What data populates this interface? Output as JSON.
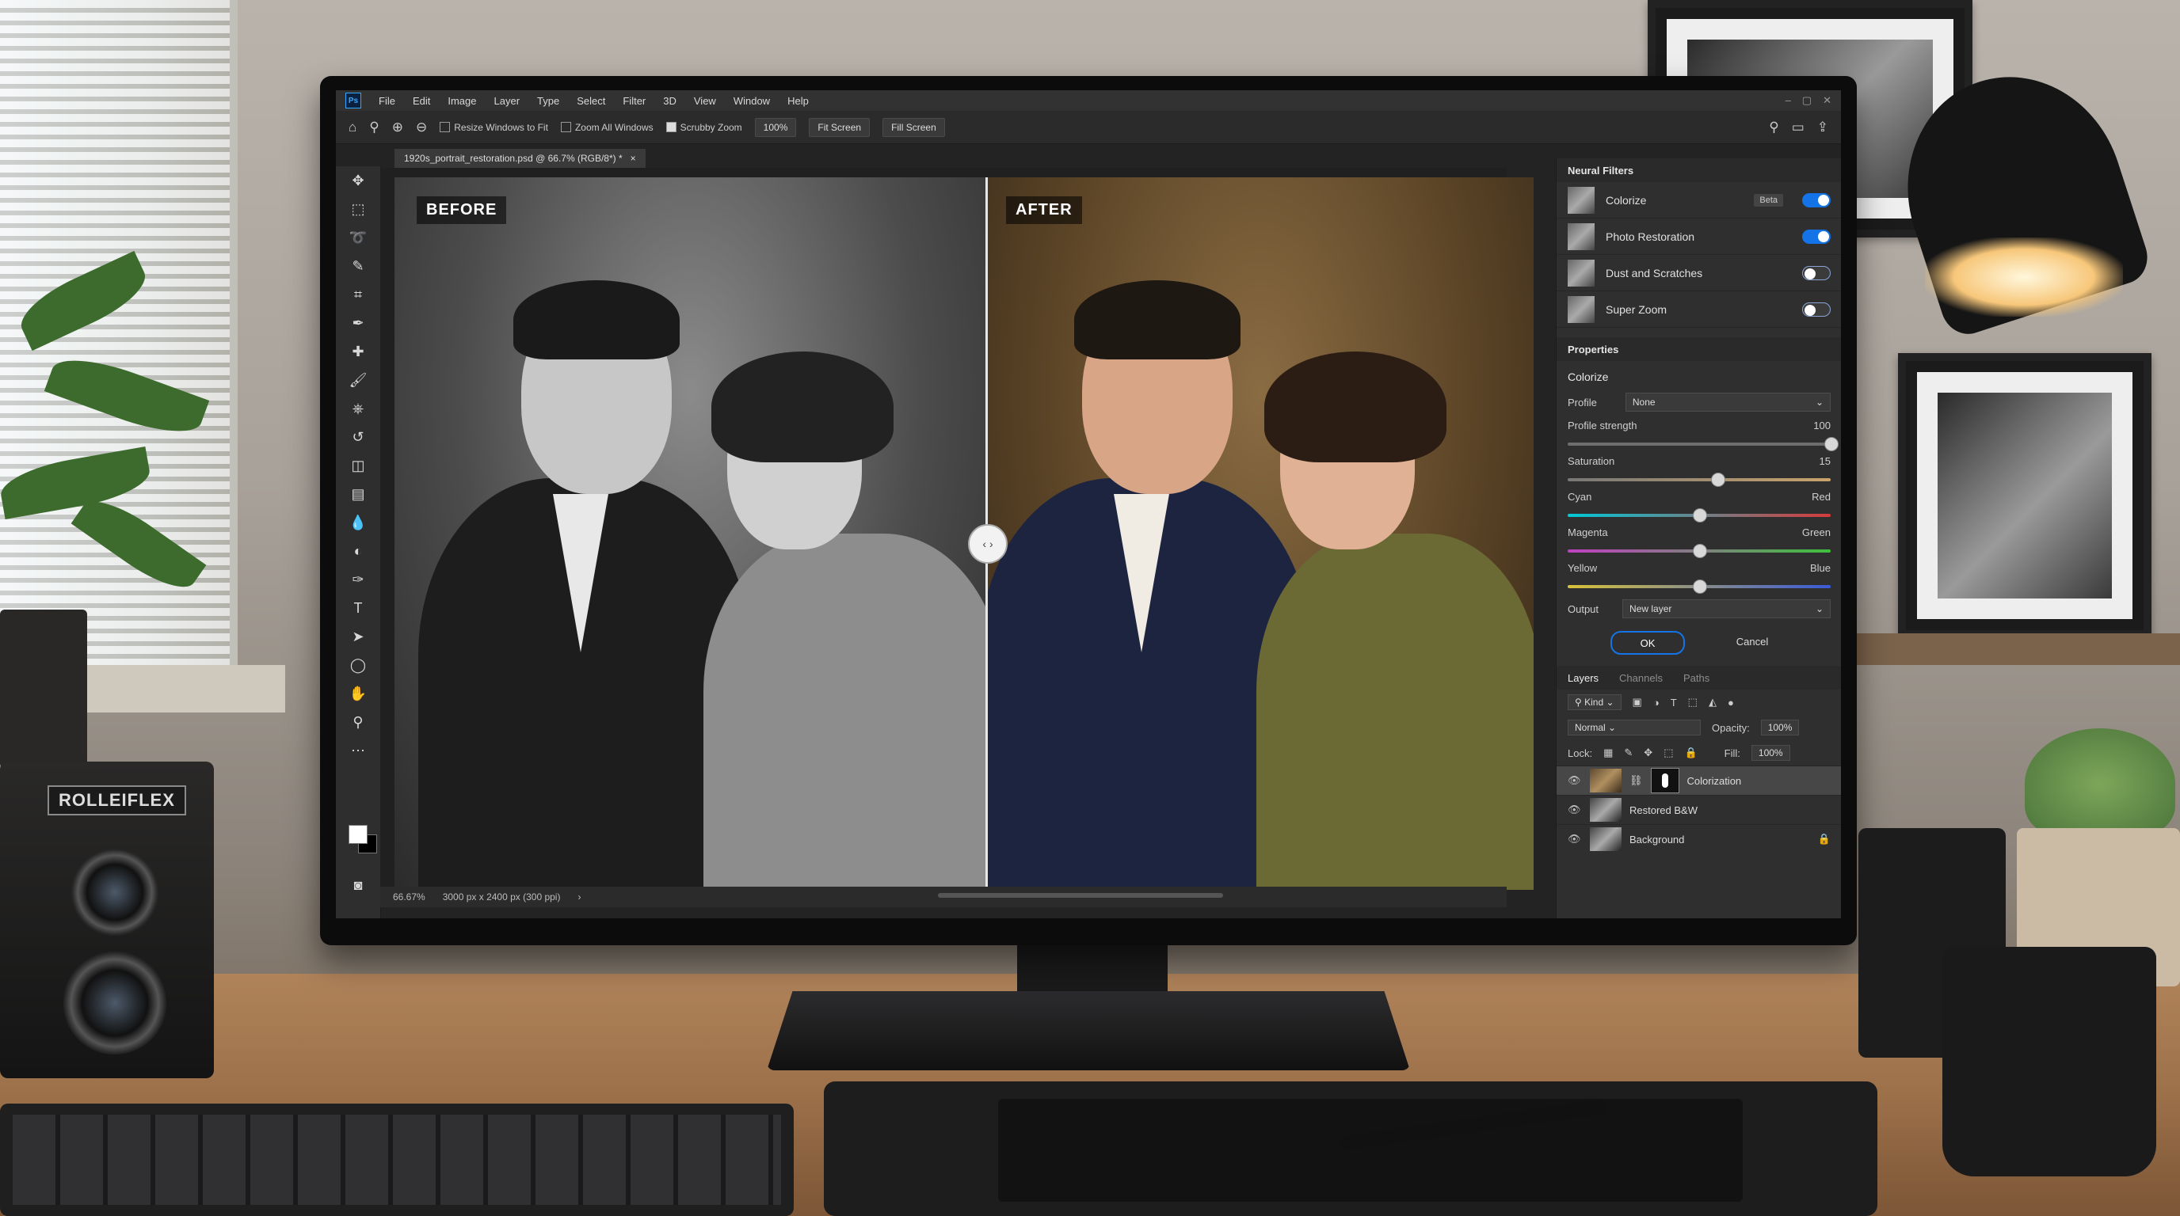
{
  "app": {
    "menu": [
      "File",
      "Edit",
      "Image",
      "Layer",
      "Type",
      "Select",
      "Filter",
      "3D",
      "View",
      "Window",
      "Help"
    ],
    "options_bar": {
      "resize_windows": "Resize Windows to Fit",
      "zoom_all": "Zoom All Windows",
      "scrubby_zoom": "Scrubby Zoom",
      "zoom_value": "100%",
      "fit_screen": "Fit Screen",
      "fill_screen": "Fill Screen"
    },
    "document_tab": "1920s_portrait_restoration.psd @ 66.7% (RGB/8*) *",
    "canvas": {
      "before_label": "BEFORE",
      "after_label": "AFTER"
    },
    "status_bar": {
      "zoom": "66.67%",
      "dimensions": "3000 px x 2400 px (300 ppi)"
    }
  },
  "neural_filters": {
    "title": "Neural Filters",
    "items": [
      {
        "name": "Colorize",
        "badge": "Beta",
        "enabled": true
      },
      {
        "name": "Photo Restoration",
        "enabled": true
      },
      {
        "name": "Dust and Scratches",
        "enabled": false
      },
      {
        "name": "Super Zoom",
        "enabled": false
      }
    ]
  },
  "properties": {
    "title": "Properties",
    "heading": "Colorize",
    "profile_label": "Profile",
    "profile_value": "None",
    "sliders": [
      {
        "left": "Profile strength",
        "right": "100",
        "value": 1.0
      },
      {
        "left": "Saturation",
        "right": "15",
        "value": 0.57
      },
      {
        "left": "Cyan",
        "right": "Red",
        "value": 0.5
      },
      {
        "left": "Magenta",
        "right": "Green",
        "value": 0.5
      },
      {
        "left": "Yellow",
        "right": "Blue",
        "value": 0.5
      }
    ],
    "output_label": "Output",
    "output_value": "New layer",
    "ok": "OK",
    "cancel": "Cancel"
  },
  "layers": {
    "tabs": [
      "Layers",
      "Channels",
      "Paths"
    ],
    "kind": "Kind",
    "blend_mode": "Normal",
    "opacity_label": "Opacity:",
    "opacity_value": "100%",
    "lock_label": "Lock:",
    "fill_label": "Fill:",
    "fill_value": "100%",
    "items": [
      {
        "name": "Colorization"
      },
      {
        "name": "Restored B&W"
      },
      {
        "name": "Background"
      }
    ]
  },
  "scene": {
    "camera_brand": "ROLLEIFLEX"
  },
  "colors": {
    "accent": "#1473e6",
    "panel": "#2f2f2f",
    "menubar": "#323232"
  }
}
